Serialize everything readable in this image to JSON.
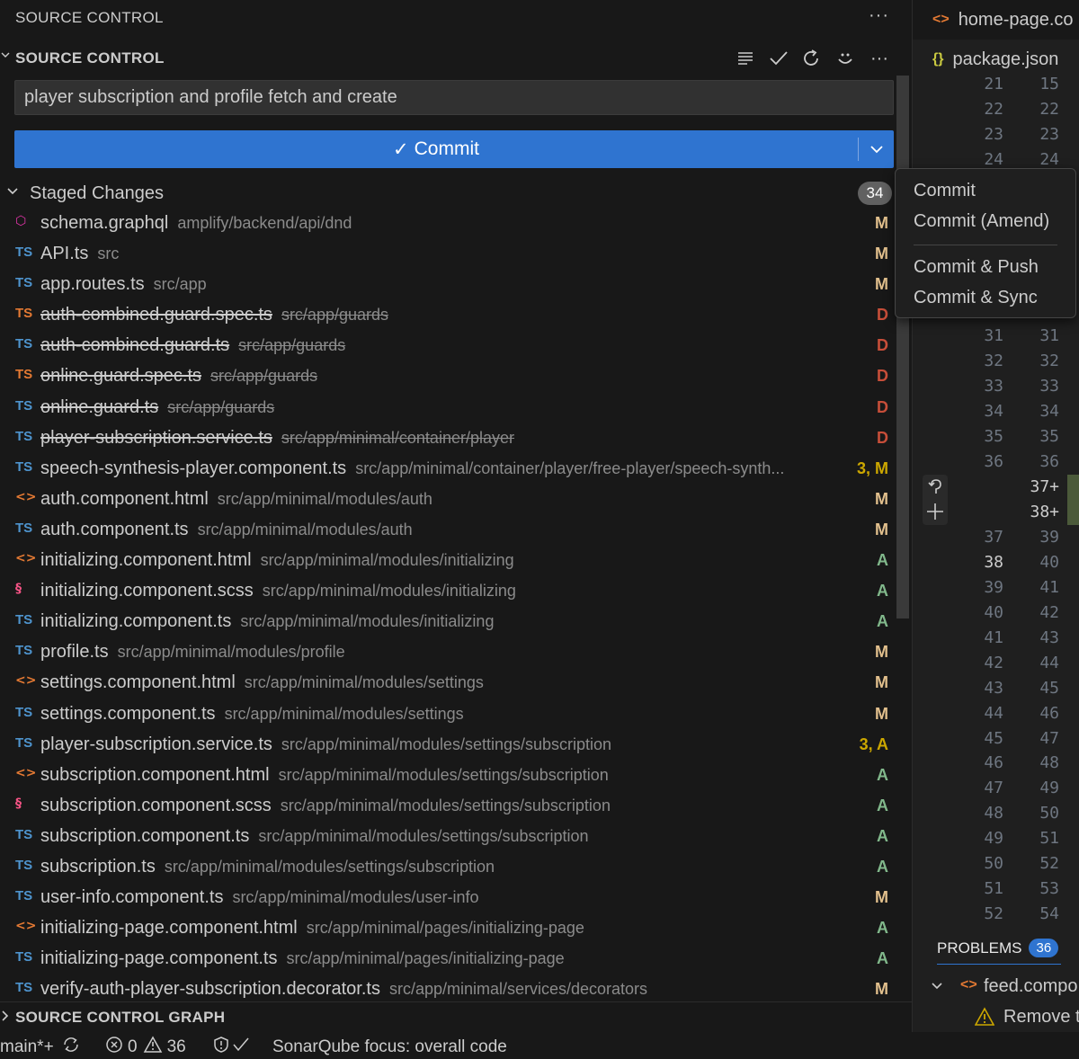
{
  "panel": {
    "title": "SOURCE CONTROL",
    "more": "···"
  },
  "scm": {
    "section_title": "SOURCE CONTROL",
    "commit_message": "player subscription and profile fetch and create",
    "commit_label": "Commit",
    "commit_check": "✓",
    "staged_title": "Staged Changes",
    "staged_count": "34",
    "graph_title": "SOURCE CONTROL GRAPH"
  },
  "files": [
    {
      "icon": "gql",
      "icon_text": "⬡",
      "name": "schema.graphql",
      "path": "amplify/backend/api/dnd",
      "status": "M",
      "deleted": false
    },
    {
      "icon": "ts",
      "icon_text": "TS",
      "name": "API.ts",
      "path": "src",
      "status": "M",
      "deleted": false
    },
    {
      "icon": "ts",
      "icon_text": "TS",
      "name": "app.routes.ts",
      "path": "src/app",
      "status": "M",
      "deleted": false
    },
    {
      "icon": "ts-del",
      "icon_text": "TS",
      "name": "auth-combined.guard.spec.ts",
      "path": "src/app/guards",
      "status": "D",
      "deleted": true
    },
    {
      "icon": "ts",
      "icon_text": "TS",
      "name": "auth-combined.guard.ts",
      "path": "src/app/guards",
      "status": "D",
      "deleted": true
    },
    {
      "icon": "ts-del",
      "icon_text": "TS",
      "name": "online.guard.spec.ts",
      "path": "src/app/guards",
      "status": "D",
      "deleted": true
    },
    {
      "icon": "ts",
      "icon_text": "TS",
      "name": "online.guard.ts",
      "path": "src/app/guards",
      "status": "D",
      "deleted": true
    },
    {
      "icon": "ts",
      "icon_text": "TS",
      "name": "player-subscription.service.ts",
      "path": "src/app/minimal/container/player",
      "status": "D",
      "deleted": true
    },
    {
      "icon": "ts",
      "icon_text": "TS",
      "name": "speech-synthesis-player.component.ts",
      "path": "src/app/minimal/container/player/free-player/speech-synth...",
      "status": "3, M",
      "deleted": false
    },
    {
      "icon": "html",
      "icon_text": "<>",
      "name": "auth.component.html",
      "path": "src/app/minimal/modules/auth",
      "status": "M",
      "deleted": false
    },
    {
      "icon": "ts",
      "icon_text": "TS",
      "name": "auth.component.ts",
      "path": "src/app/minimal/modules/auth",
      "status": "M",
      "deleted": false
    },
    {
      "icon": "html",
      "icon_text": "<>",
      "name": "initializing.component.html",
      "path": "src/app/minimal/modules/initializing",
      "status": "A",
      "deleted": false
    },
    {
      "icon": "scss",
      "icon_text": "§",
      "name": "initializing.component.scss",
      "path": "src/app/minimal/modules/initializing",
      "status": "A",
      "deleted": false
    },
    {
      "icon": "ts",
      "icon_text": "TS",
      "name": "initializing.component.ts",
      "path": "src/app/minimal/modules/initializing",
      "status": "A",
      "deleted": false
    },
    {
      "icon": "ts",
      "icon_text": "TS",
      "name": "profile.ts",
      "path": "src/app/minimal/modules/profile",
      "status": "M",
      "deleted": false
    },
    {
      "icon": "html",
      "icon_text": "<>",
      "name": "settings.component.html",
      "path": "src/app/minimal/modules/settings",
      "status": "M",
      "deleted": false
    },
    {
      "icon": "ts",
      "icon_text": "TS",
      "name": "settings.component.ts",
      "path": "src/app/minimal/modules/settings",
      "status": "M",
      "deleted": false
    },
    {
      "icon": "ts",
      "icon_text": "TS",
      "name": "player-subscription.service.ts",
      "path": "src/app/minimal/modules/settings/subscription",
      "status": "3, A",
      "deleted": false
    },
    {
      "icon": "html",
      "icon_text": "<>",
      "name": "subscription.component.html",
      "path": "src/app/minimal/modules/settings/subscription",
      "status": "A",
      "deleted": false
    },
    {
      "icon": "scss",
      "icon_text": "§",
      "name": "subscription.component.scss",
      "path": "src/app/minimal/modules/settings/subscription",
      "status": "A",
      "deleted": false
    },
    {
      "icon": "ts",
      "icon_text": "TS",
      "name": "subscription.component.ts",
      "path": "src/app/minimal/modules/settings/subscription",
      "status": "A",
      "deleted": false
    },
    {
      "icon": "ts",
      "icon_text": "TS",
      "name": "subscription.ts",
      "path": "src/app/minimal/modules/settings/subscription",
      "status": "A",
      "deleted": false
    },
    {
      "icon": "ts",
      "icon_text": "TS",
      "name": "user-info.component.ts",
      "path": "src/app/minimal/modules/user-info",
      "status": "M",
      "deleted": false
    },
    {
      "icon": "html",
      "icon_text": "<>",
      "name": "initializing-page.component.html",
      "path": "src/app/minimal/pages/initializing-page",
      "status": "A",
      "deleted": false
    },
    {
      "icon": "ts",
      "icon_text": "TS",
      "name": "initializing-page.component.ts",
      "path": "src/app/minimal/pages/initializing-page",
      "status": "A",
      "deleted": false
    },
    {
      "icon": "ts",
      "icon_text": "TS",
      "name": "verify-auth-player-subscription.decorator.ts",
      "path": "src/app/minimal/services/decorators",
      "status": "M",
      "deleted": false
    }
  ],
  "menu": {
    "items": [
      "Commit",
      "Commit (Amend)",
      "Commit & Push",
      "Commit & Sync"
    ]
  },
  "editor": {
    "tab1": "home-page.co",
    "tab2": "package.json",
    "lines": [
      [
        "21",
        "15"
      ],
      [
        "22",
        "22"
      ],
      [
        "23",
        "23"
      ],
      [
        "24",
        "24"
      ],
      [
        "31",
        "31"
      ],
      [
        "32",
        "32"
      ],
      [
        "33",
        "33"
      ],
      [
        "34",
        "34"
      ],
      [
        "35",
        "35"
      ],
      [
        "36",
        "36"
      ],
      [
        "",
        "37+"
      ],
      [
        "",
        "38+"
      ],
      [
        "37",
        "39"
      ],
      [
        "38",
        "40"
      ],
      [
        "39",
        "41"
      ],
      [
        "40",
        "42"
      ],
      [
        "41",
        "43"
      ],
      [
        "42",
        "44"
      ],
      [
        "43",
        "45"
      ],
      [
        "44",
        "46"
      ],
      [
        "45",
        "47"
      ],
      [
        "46",
        "48"
      ],
      [
        "47",
        "49"
      ],
      [
        "48",
        "50"
      ],
      [
        "49",
        "51"
      ],
      [
        "50",
        "52"
      ],
      [
        "51",
        "53"
      ],
      [
        "52",
        "54"
      ]
    ]
  },
  "problems": {
    "label": "PROBLEMS",
    "count": "36",
    "row1": "feed.compo",
    "row2": "Remove t"
  },
  "statusbar": {
    "branch": "main*+",
    "errors": "0",
    "warnings": "36",
    "sonar": "SonarQube focus: overall code"
  },
  "colors": {
    "accent": "#2f74d0",
    "modified": "#e2c08d",
    "deleted": "#c74e39",
    "added": "#81b88b"
  }
}
